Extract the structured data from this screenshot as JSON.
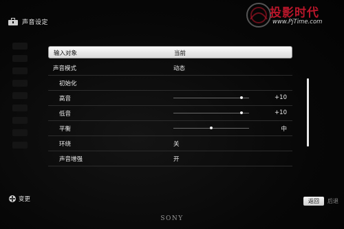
{
  "header": {
    "title": "声音设定"
  },
  "watermark": {
    "text": "投影时代",
    "url": "www.PjTime.com"
  },
  "menu": {
    "items": [
      {
        "label": "输入对象",
        "value": "当前",
        "selected": true
      },
      {
        "label": "声音模式",
        "value": "动态"
      },
      {
        "label": "初始化",
        "value": ""
      },
      {
        "label": "高音",
        "slider_value": "+10",
        "level": 0.9
      },
      {
        "label": "低音",
        "slider_value": "+10",
        "level": 0.9
      },
      {
        "label": "平衡",
        "slider_value": "中",
        "level": 0.5
      },
      {
        "label": "环绕",
        "value": "关"
      },
      {
        "label": "声音增强",
        "value": "开"
      }
    ]
  },
  "footer": {
    "change_label": "变更",
    "return_label": "返回",
    "back_label": "后退"
  },
  "brand": "SONY",
  "colors": {
    "selected_bg": "#f0f0f0",
    "logo_red": "#b8162a",
    "background": "#050505"
  }
}
